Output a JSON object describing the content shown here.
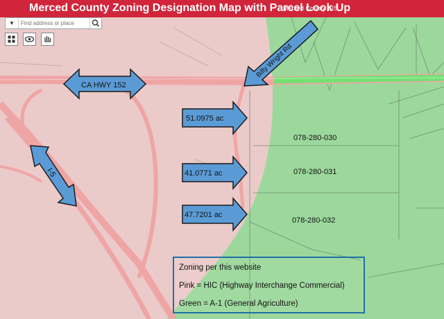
{
  "header": {
    "title": "Merced County Zoning Designation Map with Parcel Look Up",
    "subtitle": "Merced County GIS"
  },
  "search": {
    "placeholder": "Find address or place"
  },
  "annotations": {
    "hwy152": "CA HWY 152",
    "billy_wright": "Billy Wright Rd",
    "i5": "I-5",
    "acre1": "51.0975 ac",
    "acre2": "41.0771 ac",
    "acre3": "47.7201 ac"
  },
  "parcels": {
    "p1": "078-280-030",
    "p2": "078-280-031",
    "p3": "078-280-032"
  },
  "legend": {
    "heading": "Zoning per this website",
    "pink": "Pink = HIC (Highway Interchange Commercial)",
    "green": "Green = A-1 (General Agriculture)"
  },
  "colors": {
    "header": "#d0253a",
    "pink_zone": "#e9c3c3",
    "green_zone": "#9bd89b",
    "arrow_fill": "#5b9bd5",
    "arrow_stroke": "#1a1a1a",
    "road": "#f2a5a5"
  }
}
